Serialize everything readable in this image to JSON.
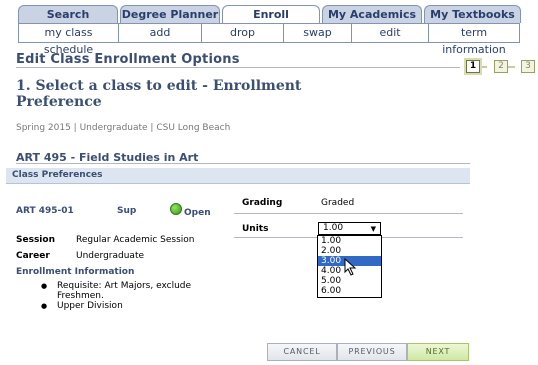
{
  "tabs": [
    "Search",
    "Degree Planner",
    "Enroll",
    "My Academics",
    "My Textbooks"
  ],
  "active_tab": "Enroll",
  "subtabs": [
    "my class schedule",
    "add",
    "drop",
    "swap",
    "edit",
    "term information"
  ],
  "page_title": "Edit Class Enrollment Options",
  "steps": [
    "1",
    "2",
    "3"
  ],
  "step_heading": "1.  Select a class to edit - Enrollment Preference",
  "term_line": "Spring 2015 | Undergraduate | CSU Long Beach",
  "course_title": "ART  495 - Field Studies in Art",
  "section_header": "Class Preferences",
  "class": {
    "number": "ART  495-01",
    "component": "Sup",
    "status": "Open",
    "session_label": "Session",
    "session_value": "Regular Academic Session",
    "career_label": "Career",
    "career_value": "Undergraduate",
    "enrollment_info_label": "Enrollment Information",
    "requirements": [
      "Requisite: Art Majors, exclude Freshmen.",
      "Upper Division"
    ]
  },
  "grading": {
    "label": "Grading",
    "value": "Graded"
  },
  "units": {
    "label": "Units",
    "selected": "1.00",
    "options": [
      "1.00",
      "2.00",
      "3.00",
      "4.00",
      "5.00",
      "6.00"
    ],
    "highlighted": "3.00"
  },
  "buttons": {
    "cancel": "CANCEL",
    "previous": "PREVIOUS",
    "next": "NEXT"
  },
  "colors": {
    "accent": "#3b4e73",
    "tab_bg": "#c9d3e3",
    "highlight": "#316ac5",
    "status_green": "#2f9c12"
  }
}
